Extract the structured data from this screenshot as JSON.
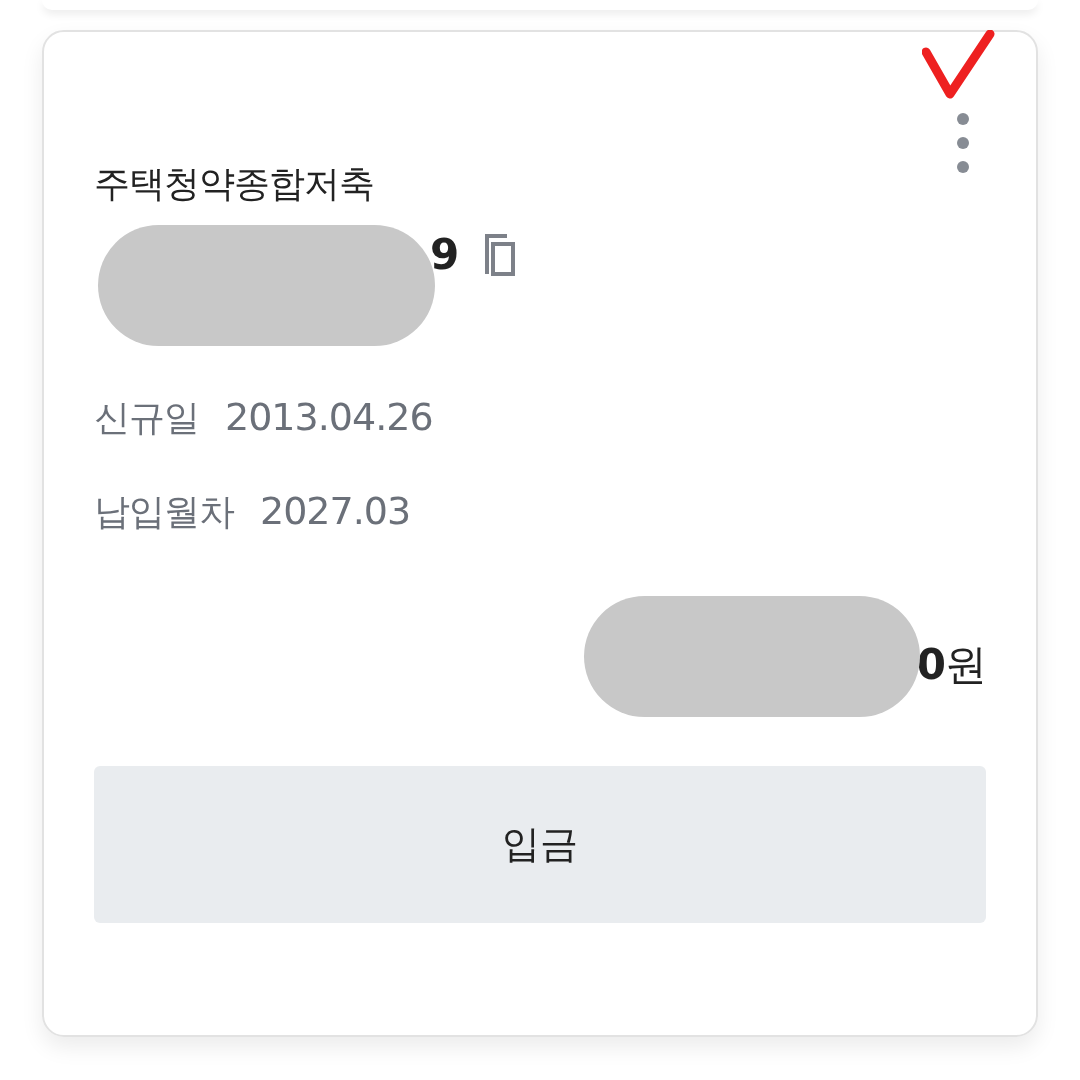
{
  "account": {
    "product_name": "주택청약종합저축",
    "number_visible": "9",
    "details": [
      {
        "label": "신규일",
        "value": "2013.04.26"
      },
      {
        "label": "납입월차",
        "value": "2027.03"
      }
    ],
    "balance": "**0**원",
    "deposit_button": "입금"
  }
}
